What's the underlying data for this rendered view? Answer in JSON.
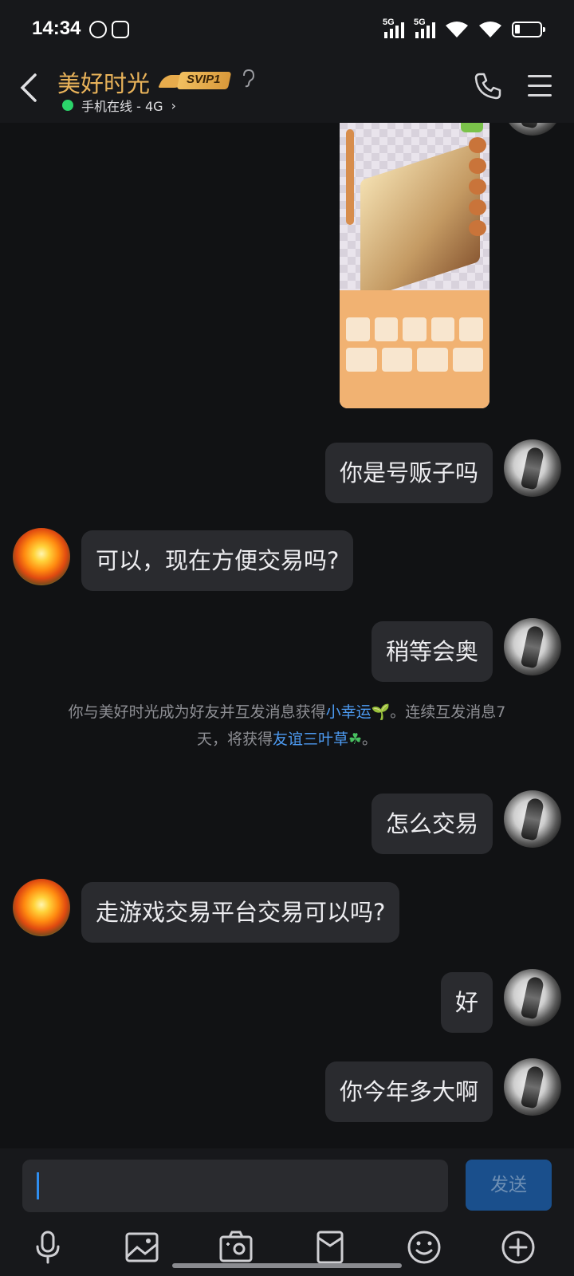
{
  "status_bar": {
    "time": "14:34",
    "sim1": "5G",
    "sim2": "5G"
  },
  "header": {
    "contact_name": "美好时光",
    "vip_badge": "SVIP1",
    "online_status": "手机在线 - 4G",
    "online_chevron": "›"
  },
  "messages": [
    {
      "from": "me",
      "text": "你是号贩子吗"
    },
    {
      "from": "them",
      "text": "可以，现在方便交易吗?"
    },
    {
      "from": "me",
      "text": "稍等会奥"
    },
    {
      "from": "me",
      "text": "怎么交易"
    },
    {
      "from": "them",
      "text": "走游戏交易平台交易可以吗?"
    },
    {
      "from": "me",
      "text": "好"
    },
    {
      "from": "me",
      "text": "你今年多大啊"
    }
  ],
  "system_message": {
    "part1": "你与美好时光成为好友并互发消息获得",
    "link1": "小幸运",
    "emoji1": "🌱",
    "part2": "。连续互发消息7",
    "part3": "天，将获得",
    "link2": "友谊三叶草",
    "emoji2": "☘",
    "part4": "。"
  },
  "input": {
    "value": "",
    "send_label": "发送"
  },
  "toolbar_icons": [
    "microphone-icon",
    "image-icon",
    "camera-icon",
    "red-packet-icon",
    "emoji-icon",
    "plus-icon"
  ],
  "colors": {
    "accent": "#4d9bf2",
    "vip_gold": "#e9b35a",
    "online_green": "#2bd46a",
    "send_button": "#1a4f8c"
  }
}
